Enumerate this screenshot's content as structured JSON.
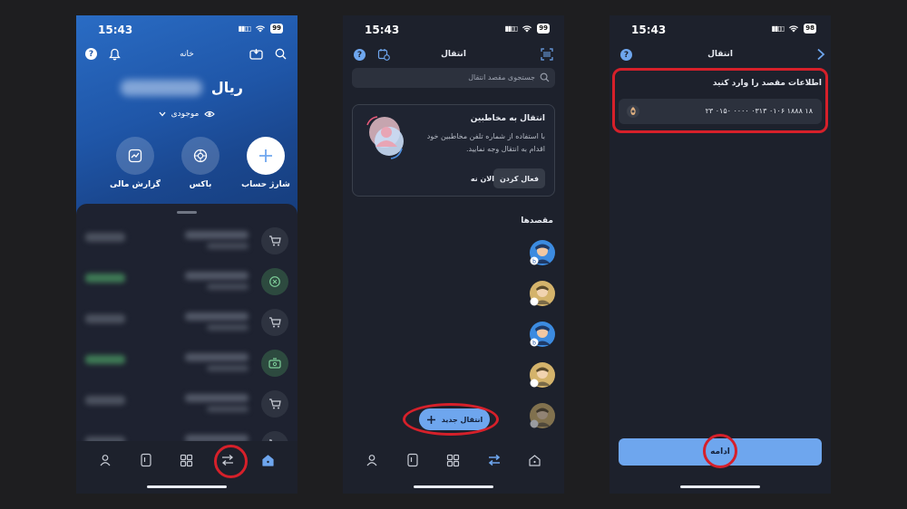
{
  "status": {
    "time": "15:43",
    "battery_1": "99",
    "battery_2": "99",
    "battery_3": "98"
  },
  "home": {
    "title": "خانه",
    "currency": "ریال",
    "stock_label": "موجودی",
    "quick_actions": [
      {
        "label": "شارژ حساب",
        "icon": "plus-icon"
      },
      {
        "label": "باکس",
        "icon": "box-icon"
      },
      {
        "label": "گزارش مالی",
        "icon": "chart-icon"
      }
    ]
  },
  "transfer": {
    "title": "انتقال",
    "search_placeholder": "جستجوی مقصد انتقال",
    "promo_title": "انتقال به مخاطبین",
    "promo_desc": "با استفاده از شماره تلفن مخاطبین خود اقدام به انتقال وجه نمایید.",
    "activate_label": "فعال کردن",
    "later_label": "الان نه",
    "destinations_label": "مقصدها",
    "new_transfer_label": "انتقال جدید"
  },
  "destination": {
    "title": "انتقال",
    "heading": "اطلاعات مقصد را وارد کنید",
    "iban": "۱۸ ۱۸۸۸ ۰۱۰۶ ۰۳۱۳ ۰۰۰۰ ۰۱۵۰ ۲۳",
    "continue_label": "ادامه"
  },
  "colors": {
    "accent": "#6ea6ee",
    "header_blue": "#1f56a8",
    "highlight_red": "#d6202a",
    "panel": "#1d212c"
  }
}
